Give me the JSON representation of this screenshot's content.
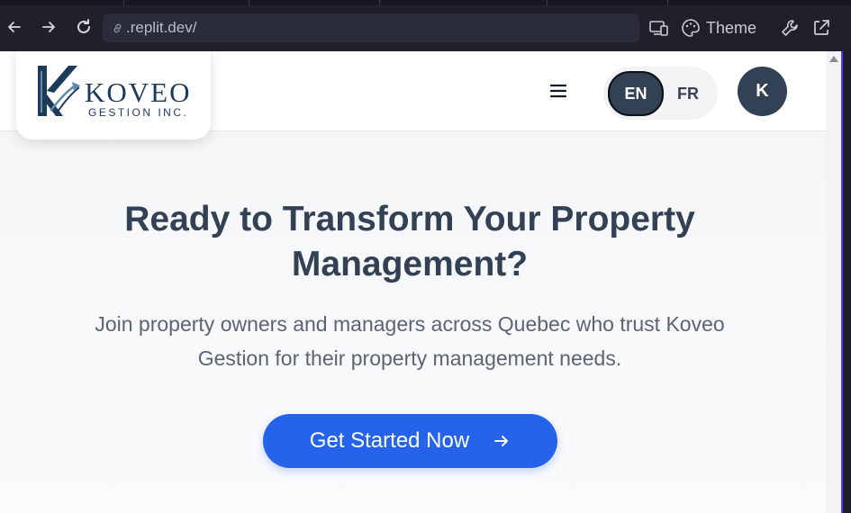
{
  "browser": {
    "url": ".replit.dev/",
    "theme_label": "Theme"
  },
  "brand": {
    "name": "KOVEO",
    "tagline": "GESTION INC."
  },
  "header": {
    "lang_en": "EN",
    "lang_fr": "FR",
    "avatar_initial": "K"
  },
  "hero": {
    "title_line1": "Ready to Transform Your Property",
    "title_line2": "Management?",
    "subtitle_line1": "Join property owners and managers across Quebec who trust Koveo",
    "subtitle_line2": "Gestion for their property management needs.",
    "cta_label": "Get Started Now"
  },
  "colors": {
    "accent": "#2563eb",
    "dark_slate": "#334155",
    "browser_bar": "#1f2029"
  },
  "icons": [
    "back-arrow-icon",
    "forward-arrow-icon",
    "reload-icon",
    "link-icon",
    "devices-icon",
    "palette-icon",
    "wrench-icon",
    "external-link-icon",
    "hamburger-menu-icon",
    "arrow-right-icon"
  ]
}
